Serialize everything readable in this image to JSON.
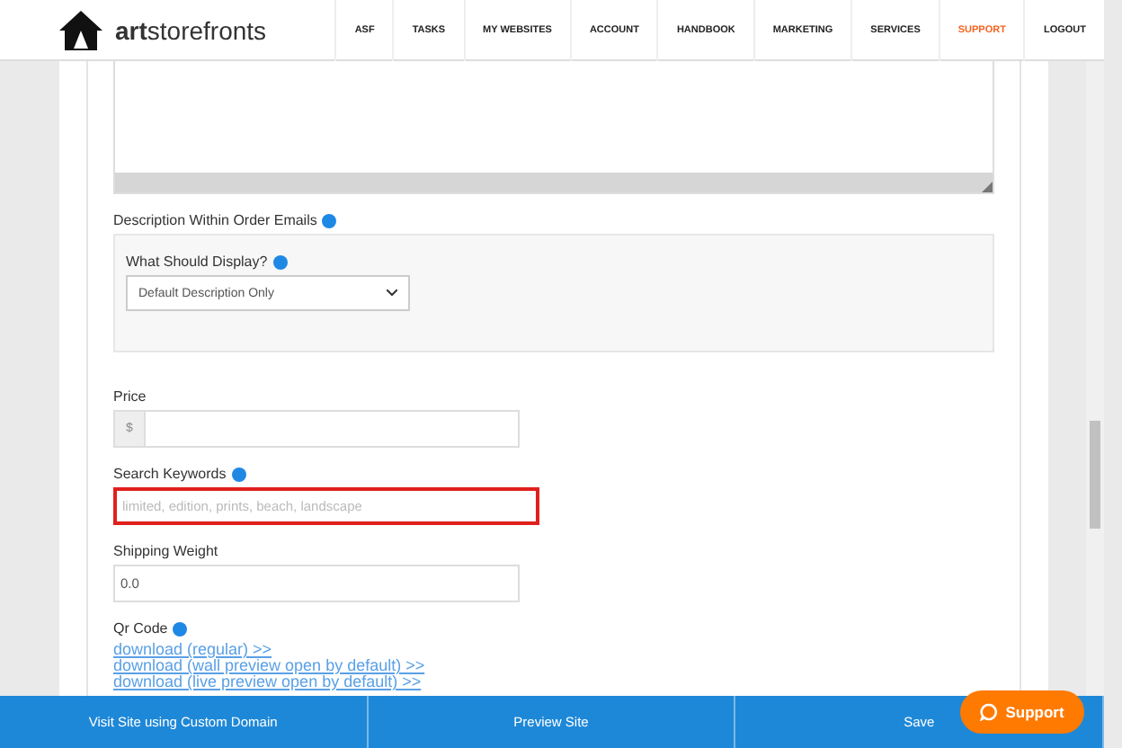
{
  "brand": {
    "name_bold": "art",
    "name_rest": "storefronts"
  },
  "nav": [
    {
      "label": "ASF",
      "selected": false
    },
    {
      "label": "TASKS",
      "selected": false
    },
    {
      "label": "MY WEBSITES",
      "selected": false
    },
    {
      "label": "ACCOUNT",
      "selected": false
    },
    {
      "label": "HANDBOOK",
      "selected": false
    },
    {
      "label": "MARKETING",
      "selected": false
    },
    {
      "label": "SERVICES",
      "selected": false
    },
    {
      "label": "SUPPORT",
      "selected": true
    },
    {
      "label": "LOGOUT",
      "selected": false
    }
  ],
  "order_emails": {
    "label": "Description Within Order Emails",
    "display_label": "What Should Display?",
    "display_value": "Default Description Only"
  },
  "price": {
    "label": "Price",
    "prefix": "$"
  },
  "keywords": {
    "label": "Search Keywords",
    "placeholder": "limited, edition, prints, beach, landscape",
    "error": true
  },
  "shipping": {
    "label": "Shipping Weight",
    "value": "0.0"
  },
  "qr": {
    "label": "Qr Code",
    "links": [
      "download (regular) >>",
      "download (wall preview open by default) >>",
      "download (live preview open by default) >>"
    ]
  },
  "footer_buttons": [
    "Visit Site using Custom Domain",
    "Preview Site",
    "Save"
  ],
  "support_button": "Support"
}
